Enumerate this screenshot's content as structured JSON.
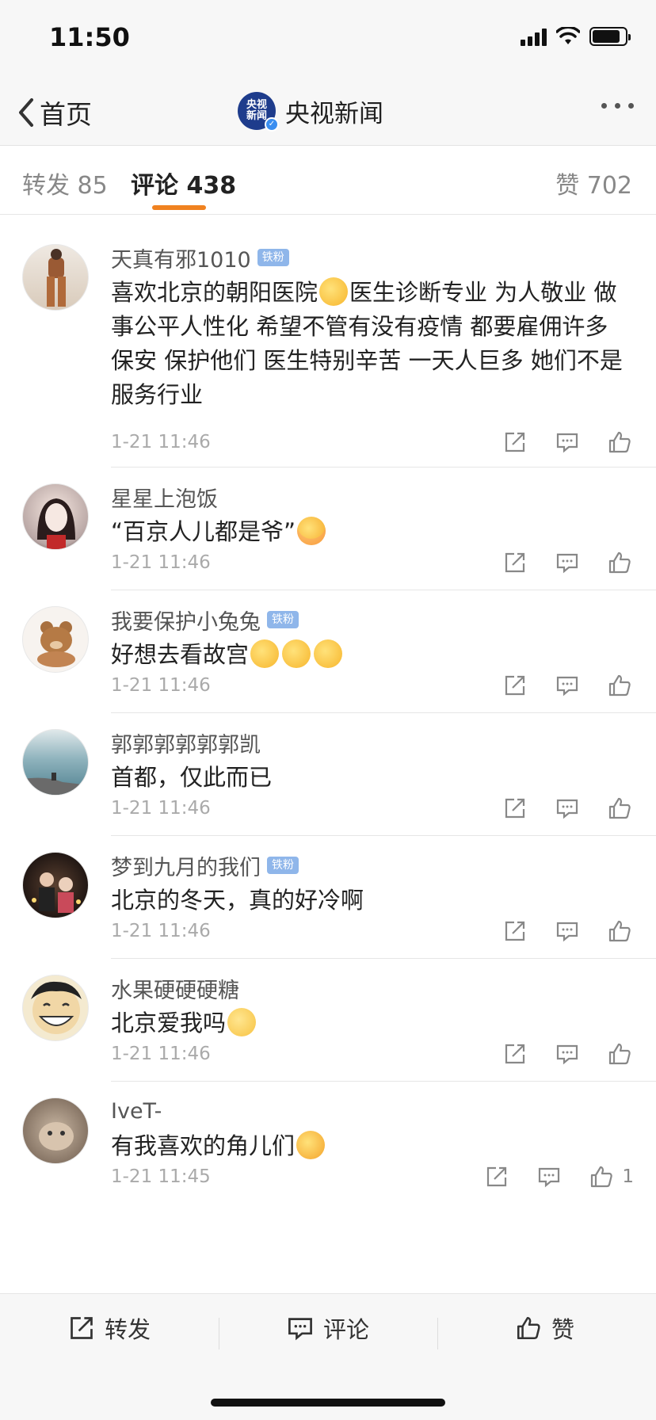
{
  "status_bar": {
    "time": "11:50"
  },
  "nav": {
    "back_label": "首页",
    "logo_text": "央视新闻",
    "title": "央视新闻"
  },
  "tabs": {
    "repost": "转发 85",
    "comment": "评论 438",
    "like": "赞 702"
  },
  "comments": [
    {
      "name": "天真有邪1010",
      "badge": "铁粉",
      "text": "喜欢北京的朝阳医院",
      "emoji": "cry-laugh-icon",
      "text2": "医生诊断专业 为人敬业 做事公平人性化 希望不管有没有疫情 都要雇佣许多保安 保护他们 医生特别辛苦 一天人巨多 她们不是服务行业",
      "time": "1-21 11:46"
    },
    {
      "name": "星星上泡饭",
      "badge": "",
      "text": "“百京人儿都是爷”",
      "emoji": "shy-icon",
      "time": "1-21 11:46"
    },
    {
      "name": "我要保护小兔兔",
      "badge": "铁粉",
      "text": "好想去看故宫",
      "emoji": "sleepy-icon",
      "time": "1-21 11:46"
    },
    {
      "name": "郭郭郭郭郭郭凯",
      "badge": "",
      "text": "首都，仅此而已",
      "time": "1-21 11:46"
    },
    {
      "name": "梦到九月的我们",
      "badge": "铁粉",
      "text": "北京的冬天，真的好冷啊",
      "time": "1-21 11:46"
    },
    {
      "name": "水果硬硬硬糖",
      "badge": "",
      "text": "北京爱我吗",
      "emoji": "shrug-icon",
      "time": "1-21 11:46"
    },
    {
      "name": "IveT-",
      "badge": "",
      "text": "有我喜欢的角儿们",
      "emoji": "happy-icon",
      "time": "1-21 11:45",
      "likes": "1"
    }
  ],
  "bottom_bar": {
    "repost": "转发",
    "comment": "评论",
    "like": "赞"
  },
  "colors": {
    "accent": "#f08220",
    "badge": "#8fb6ea",
    "logo": "#1e3c8c"
  }
}
